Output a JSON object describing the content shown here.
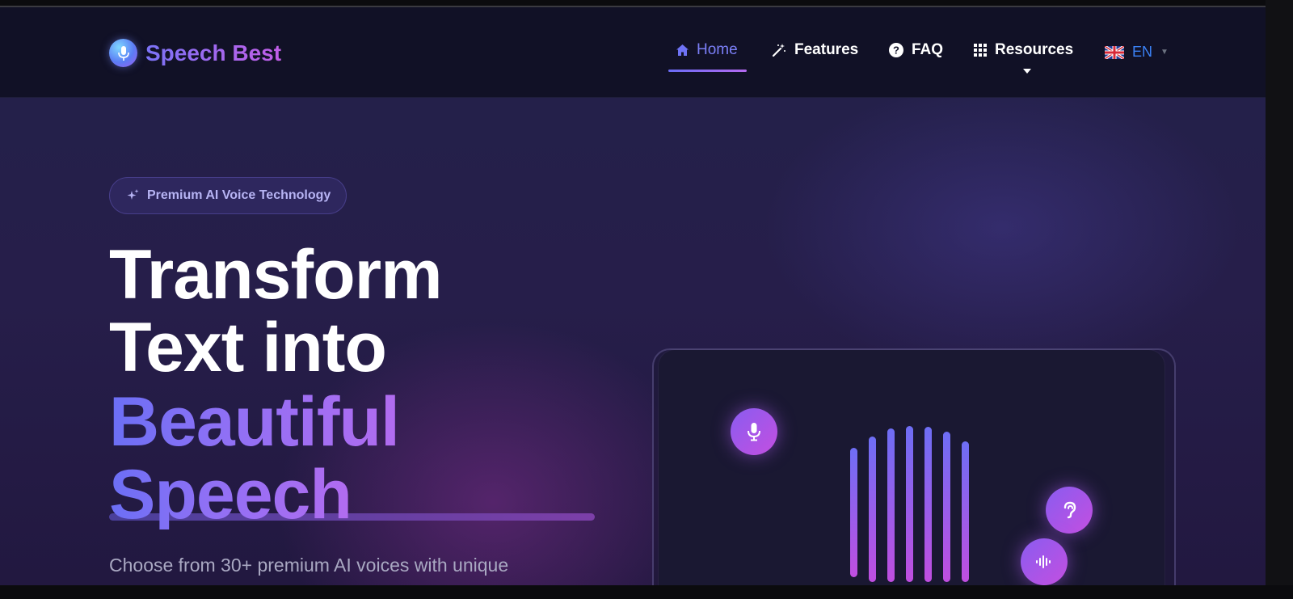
{
  "brand": {
    "name": "Speech Best",
    "icon": "microphone-logo-icon"
  },
  "nav": {
    "items": [
      {
        "label": "Home",
        "icon": "home-icon",
        "active": true
      },
      {
        "label": "Features",
        "icon": "magic-wand-icon"
      },
      {
        "label": "FAQ",
        "icon": "question-circle-icon"
      },
      {
        "label": "Resources",
        "icon": "grid-icon",
        "has_dropdown": true
      }
    ],
    "language": {
      "label": "EN",
      "icon": "uk-flag-icon"
    }
  },
  "hero": {
    "badge": "Premium AI Voice Technology",
    "badge_icon": "sparkles-icon",
    "title_line1": "Transform",
    "title_line2": "Text into",
    "title_line3": "Beautiful",
    "title_line4": "Speech",
    "subtitle": "Choose from 30+ premium AI voices with unique"
  },
  "visual": {
    "orbs": [
      "microphone-icon",
      "ear-icon",
      "sound-wave-icon"
    ]
  },
  "colors": {
    "accent": "#7b7ff7",
    "gradient_start": "#6b6ff5",
    "gradient_end": "#c04ee0",
    "header_bg": "#111126",
    "lang_blue": "#3b82f6"
  }
}
